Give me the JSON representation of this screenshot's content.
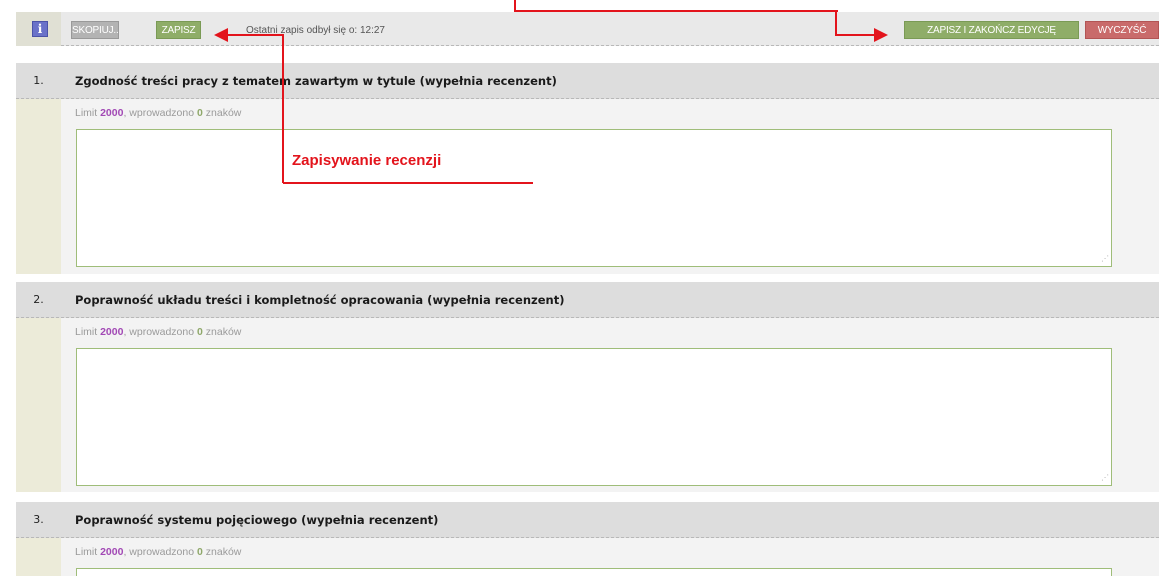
{
  "toolbar": {
    "info_icon": "info-icon",
    "copy_label": "SKOPIUJ...",
    "save_label": "ZAPISZ",
    "last_save_text": "Ostatni zapis odbył się o: 12:27",
    "finish_label": "ZAPISZ I ZAKOŃCZ EDYCJĘ",
    "clear_label": "WYCZYŚĆ"
  },
  "sections": [
    {
      "number": "1.",
      "title": "Zgodność treści pracy z tematem zawartym w tytule (wypełnia recenzent)",
      "limit_prefix": "Limit ",
      "limit": "2000",
      "entered_prefix": ", wprowadzono ",
      "entered": "0",
      "entered_suffix": " znaków",
      "value": ""
    },
    {
      "number": "2.",
      "title": "Poprawność układu treści i kompletność opracowania (wypełnia recenzent)",
      "limit_prefix": "Limit ",
      "limit": "2000",
      "entered_prefix": ", wprowadzono ",
      "entered": "0",
      "entered_suffix": " znaków",
      "value": ""
    },
    {
      "number": "3.",
      "title": "Poprawność systemu pojęciowego (wypełnia recenzent)",
      "limit_prefix": "Limit ",
      "limit": "2000",
      "entered_prefix": ", wprowadzono ",
      "entered": "0",
      "entered_suffix": " znaków",
      "value": ""
    }
  ],
  "annotations": {
    "save_review": "Zapisywanie recenzji"
  },
  "colors": {
    "save_green": "#8fad68",
    "clear_red": "#c96b6b",
    "annotation_red": "#e3141c",
    "limit_purple": "#a249b5"
  }
}
